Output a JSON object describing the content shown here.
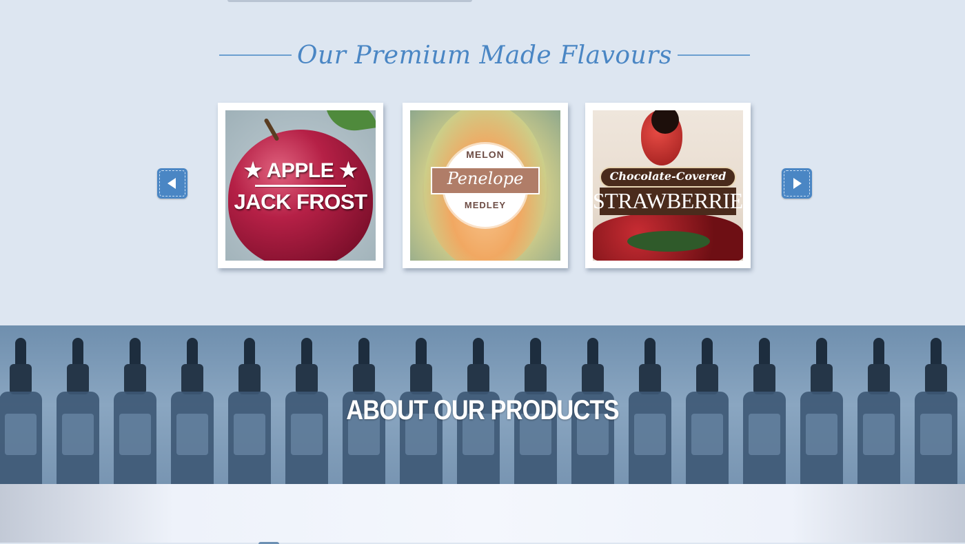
{
  "heading": {
    "title": "Our Premium Made Flavours"
  },
  "carousel": {
    "prev_icon": "arrow-left-icon",
    "next_icon": "arrow-right-icon",
    "accent": "#4a86c4",
    "cards": [
      {
        "line1": "★ APPLE ★",
        "line2": "JACK FROST"
      },
      {
        "top": "MELON",
        "middle": "Penelope",
        "bottom": "MEDLEY"
      },
      {
        "small": "Chocolate-Covered",
        "big": "STRAWBERRIES"
      }
    ]
  },
  "about": {
    "title": "ABOUT OUR PRODUCTS"
  }
}
